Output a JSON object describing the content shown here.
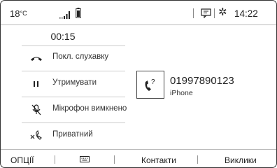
{
  "status": {
    "temperature": "18",
    "temp_unit": "°C",
    "time": "14:22",
    "icons": [
      "signal-icon",
      "battery-icon",
      "message-icon",
      "gear-icon"
    ]
  },
  "call": {
    "duration": "00:15",
    "actions": [
      {
        "label": "Покл. слухавку",
        "icon": "hang-up-icon"
      },
      {
        "label": "Утримувати",
        "icon": "pause-icon"
      },
      {
        "label": "Мікрофон вимкнено",
        "icon": "mic-muted-icon"
      },
      {
        "label": "Приватний",
        "icon": "private-call-icon"
      }
    ]
  },
  "contact": {
    "number": "01997890123",
    "device": "iPhone",
    "avatar_icon": "unknown-caller-icon"
  },
  "bottom_bar": {
    "options": "ОПЦІЇ",
    "keypad_icon": "keypad-icon",
    "contacts": "Контакти",
    "calls": "Виклики"
  }
}
